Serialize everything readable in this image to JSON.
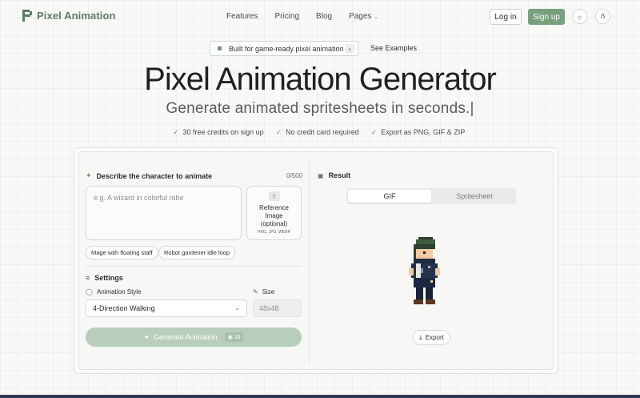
{
  "brand": {
    "name": "Pixel Animation"
  },
  "nav": {
    "links": [
      "Features",
      "Pricing",
      "Blog",
      "Pages"
    ],
    "login_label": "Log in",
    "signup_label": "Sign up"
  },
  "hero": {
    "badge": "Built for game-ready pixel animation",
    "see_examples": "See Examples",
    "title": "Pixel Animation Generator",
    "subtitle": "Generate animated spritesheets in seconds.|",
    "checks": [
      "30 free credits on sign up",
      "No credit card required",
      "Export as PNG, GIF & ZIP"
    ]
  },
  "form": {
    "describe_heading": "Describe the character to animate",
    "counter": "0/500",
    "desc_placeholder": "e.g. A wizard in colorful robe",
    "reference": {
      "line1": "Reference",
      "line2": "Image",
      "line3": "(optional)",
      "formats": "PNG, JPG, WEBP"
    },
    "chips": [
      "Mage with floating staff",
      "Robot gardener idle loop"
    ],
    "settings_heading": "Settings",
    "animation_style_label": "Animation Style",
    "animation_style_value": "4-Direction Walking",
    "size_label": "Size",
    "size_value": "48x48",
    "generate_label": "Generate Animation",
    "generate_cost": "16"
  },
  "result": {
    "heading": "Result",
    "tabs": [
      "GIF",
      "Spritesheet"
    ],
    "active_tab": "GIF",
    "export_label": "Export"
  },
  "colors": {
    "accent": "#789f7e",
    "brand_text": "#5e7c65"
  }
}
